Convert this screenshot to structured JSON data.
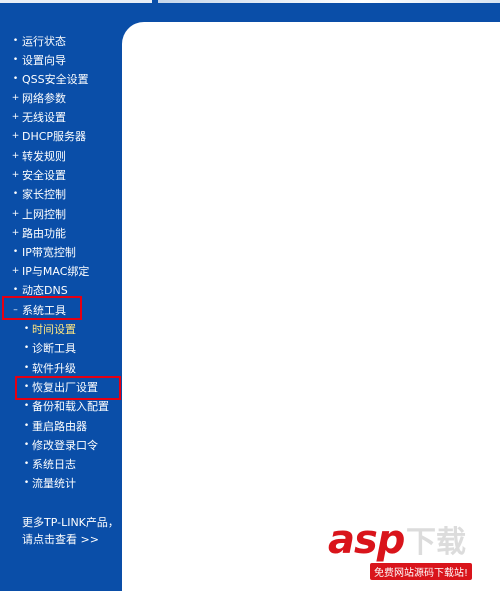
{
  "menu": {
    "items": [
      {
        "label": "运行状态",
        "marker": "•"
      },
      {
        "label": "设置向导",
        "marker": "•"
      },
      {
        "label": "QSS安全设置",
        "marker": "•"
      },
      {
        "label": "网络参数",
        "marker": "+"
      },
      {
        "label": "无线设置",
        "marker": "+"
      },
      {
        "label": "DHCP服务器",
        "marker": "+"
      },
      {
        "label": "转发规则",
        "marker": "+"
      },
      {
        "label": "安全设置",
        "marker": "+"
      },
      {
        "label": "家长控制",
        "marker": "•"
      },
      {
        "label": "上网控制",
        "marker": "+"
      },
      {
        "label": "路由功能",
        "marker": "+"
      },
      {
        "label": "IP带宽控制",
        "marker": "•"
      },
      {
        "label": "IP与MAC绑定",
        "marker": "+"
      },
      {
        "label": "动态DNS",
        "marker": "•"
      },
      {
        "label": "系统工具",
        "marker": "–"
      }
    ],
    "sub_items": [
      {
        "label": "时间设置",
        "marker": "•"
      },
      {
        "label": "诊断工具",
        "marker": "•"
      },
      {
        "label": "软件升级",
        "marker": "•"
      },
      {
        "label": "恢复出厂设置",
        "marker": "•"
      },
      {
        "label": "备份和载入配置",
        "marker": "•"
      },
      {
        "label": "重启路由器",
        "marker": "•"
      },
      {
        "label": "修改登录口令",
        "marker": "•"
      },
      {
        "label": "系统日志",
        "marker": "•"
      },
      {
        "label": "流量统计",
        "marker": "•"
      }
    ]
  },
  "promo": {
    "line1": "更多TP-LINK产品，",
    "line2": "请点击查看 >>"
  },
  "watermark": {
    "brand": "asp",
    "cn": "下载",
    "sub": "免费网站源码下载站!"
  },
  "colors": {
    "sidebar_bg": "#0a4ea8",
    "highlight": "#e60012",
    "active_item": "#ffe680"
  }
}
